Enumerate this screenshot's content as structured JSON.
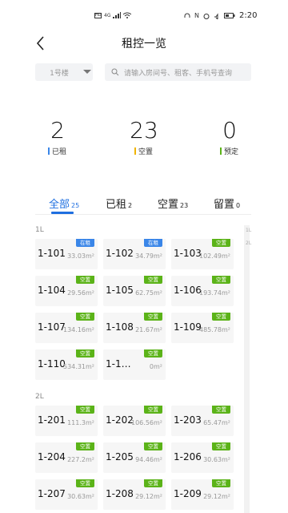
{
  "status_bar": {
    "time": "2:20",
    "network": "4G"
  },
  "header": {
    "title": "租控一览"
  },
  "filter": {
    "building": "1号楼",
    "search_placeholder": "请输入房间号、租客、手机号查询"
  },
  "stats": [
    {
      "value": "2",
      "label": "已租",
      "color": "#3a86e8"
    },
    {
      "value": "23",
      "label": "空置",
      "color": "#f0b400"
    },
    {
      "value": "0",
      "label": "预定",
      "color": "#5bb318"
    }
  ],
  "tabs": [
    {
      "label": "全部",
      "count": "25",
      "active": true
    },
    {
      "label": "已租",
      "count": "2"
    },
    {
      "label": "空置",
      "count": "23"
    },
    {
      "label": "留置",
      "count": "0"
    }
  ],
  "side_floors": [
    "1L",
    "2L"
  ],
  "floors": [
    {
      "name": "1L",
      "rooms": [
        {
          "no": "1-101",
          "area": "33.03m²",
          "status": "在租"
        },
        {
          "no": "1-102",
          "area": "34.79m²",
          "status": "在租"
        },
        {
          "no": "1-103",
          "area": "102.49m²",
          "status": "空置"
        },
        {
          "no": "1-104",
          "area": "29.56m²",
          "status": "空置"
        },
        {
          "no": "1-105",
          "area": "62.75m²",
          "status": "空置"
        },
        {
          "no": "1-106",
          "area": "193.74m²",
          "status": "空置"
        },
        {
          "no": "1-107",
          "area": "134.16m²",
          "status": "空置"
        },
        {
          "no": "1-108",
          "area": "21.67m²",
          "status": "空置"
        },
        {
          "no": "1-109",
          "area": "485.78m²",
          "status": "空置"
        },
        {
          "no": "1-110",
          "area": "534.31m²",
          "status": "空置"
        },
        {
          "no": "1-1…",
          "area": "0m²",
          "status": "空置"
        }
      ]
    },
    {
      "name": "2L",
      "rooms": [
        {
          "no": "1-201",
          "area": "111.3m²",
          "status": "空置"
        },
        {
          "no": "1-202",
          "area": "106.56m²",
          "status": "空置"
        },
        {
          "no": "1-203",
          "area": "65.47m²",
          "status": "空置"
        },
        {
          "no": "1-204",
          "area": "227.2m²",
          "status": "空置"
        },
        {
          "no": "1-205",
          "area": "94.46m²",
          "status": "空置"
        },
        {
          "no": "1-206",
          "area": "30.63m²",
          "status": "空置"
        },
        {
          "no": "1-207",
          "area": "30.63m²",
          "status": "空置"
        },
        {
          "no": "1-208",
          "area": "29.12m²",
          "status": "空置"
        },
        {
          "no": "1-209",
          "area": "29.12m²",
          "status": "空置"
        }
      ]
    }
  ]
}
